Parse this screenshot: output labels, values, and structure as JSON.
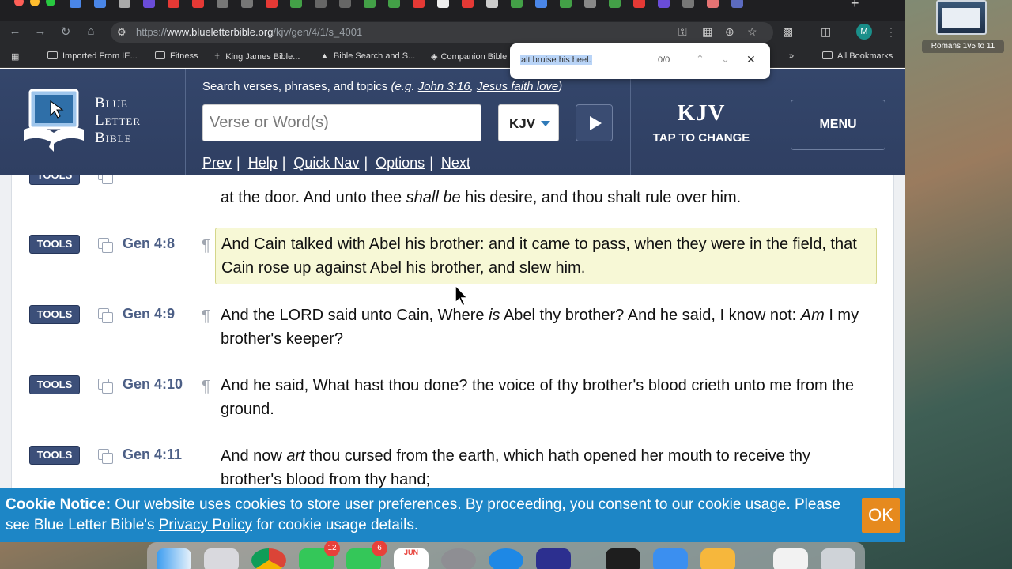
{
  "browser": {
    "url_prefix": "https://",
    "url_host": "www.blueletterbible.org",
    "url_path": "/kjv/gen/4/1/s_4001",
    "profile_initial": "M",
    "bookmarks": [
      {
        "label": "Imported From IE..."
      },
      {
        "label": "Fitness"
      },
      {
        "label": "King James Bible..."
      },
      {
        "label": "Bible Search and S..."
      },
      {
        "label": "Companion Bible"
      }
    ],
    "all_bookmarks": "All Bookmarks",
    "more_bookmarks": "»"
  },
  "findbar": {
    "query": "alt bruise his heel.",
    "count": "0/0"
  },
  "desktop": {
    "thumb_label": "Romans 1v5 to 11"
  },
  "header": {
    "logo_lines": [
      "Blue",
      "Letter",
      "Bible"
    ],
    "search_hint_prefix": "Search verses, phrases, and topics ",
    "search_hint_eg": "(e.g. ",
    "search_hint_example1": "John 3:16",
    "search_hint_comma": ", ",
    "search_hint_example2": "Jesus faith love",
    "search_hint_close": ")",
    "search_placeholder": "Verse or Word(s)",
    "version": "KJV",
    "nav": [
      "Prev",
      "Help",
      "Quick Nav",
      "Options",
      "Next"
    ],
    "kjv_big": "KJV",
    "kjv_small": "TAP TO CHANGE",
    "menu": "MENU"
  },
  "verses": [
    {
      "ref": "",
      "tools": "TOOLS",
      "pilcrow": false,
      "text_html": "at the door. And unto thee <i>shall be</i> his desire, and thou shalt rule over him.",
      "partial": true
    },
    {
      "ref": "Gen 4:8",
      "tools": "TOOLS",
      "pilcrow": true,
      "highlight": true,
      "text_html": "And Cain talked with Abel his brother: and it came to pass, when they were in the field, that Cain rose up against Abel his brother, and slew him."
    },
    {
      "ref": "Gen 4:9",
      "tools": "TOOLS",
      "pilcrow": true,
      "text_html": "And the LORD said unto Cain, Where <i>is</i> Abel thy brother? And he said, I know not: <i>Am</i> I my brother's keeper?"
    },
    {
      "ref": "Gen 4:10",
      "tools": "TOOLS",
      "pilcrow": true,
      "text_html": "And he said, What hast thou done? the voice of thy brother's blood crieth unto me from the ground."
    },
    {
      "ref": "Gen 4:11",
      "tools": "TOOLS",
      "pilcrow": false,
      "text_html": "And now <i>art</i> thou cursed from the earth, which hath opened her mouth to receive thy brother's blood from thy hand;"
    }
  ],
  "cookie": {
    "title": "Cookie Notice:",
    "text1": " Our website uses cookies to store user preferences. By proceeding, you consent to our cookie usage. Please see Blue Letter Bible's ",
    "link": "Privacy Policy",
    "text2": " for cookie usage details.",
    "ok": "OK"
  },
  "dock": {
    "messages_badge": "12",
    "facetime_badge": "6",
    "calendar_month": "JUN"
  },
  "colors": {
    "header_bg": "#34466b",
    "tools_bg": "#3c4f79",
    "highlight_bg": "#f7f8d6",
    "cookie_bg": "#1d86c6",
    "ok_bg": "#e68a1e"
  }
}
